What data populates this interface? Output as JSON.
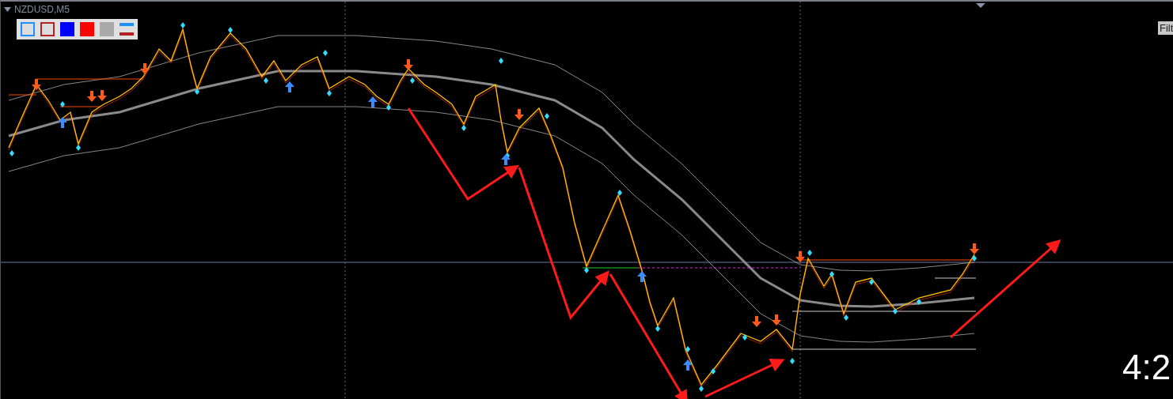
{
  "chart": {
    "symbol": "NZDUSD,M5",
    "filter_button": "Filt",
    "timer": "4:2"
  },
  "swatches": [
    {
      "kind": "outline",
      "color": "#1e90ff"
    },
    {
      "kind": "outline",
      "color": "#b22222"
    },
    {
      "kind": "fill",
      "color": "#0000ff"
    },
    {
      "kind": "fill",
      "color": "#ff0000"
    },
    {
      "kind": "fill",
      "color": "#a9a9a9"
    },
    {
      "kind": "lines",
      "color": "#1e90ff"
    }
  ]
}
